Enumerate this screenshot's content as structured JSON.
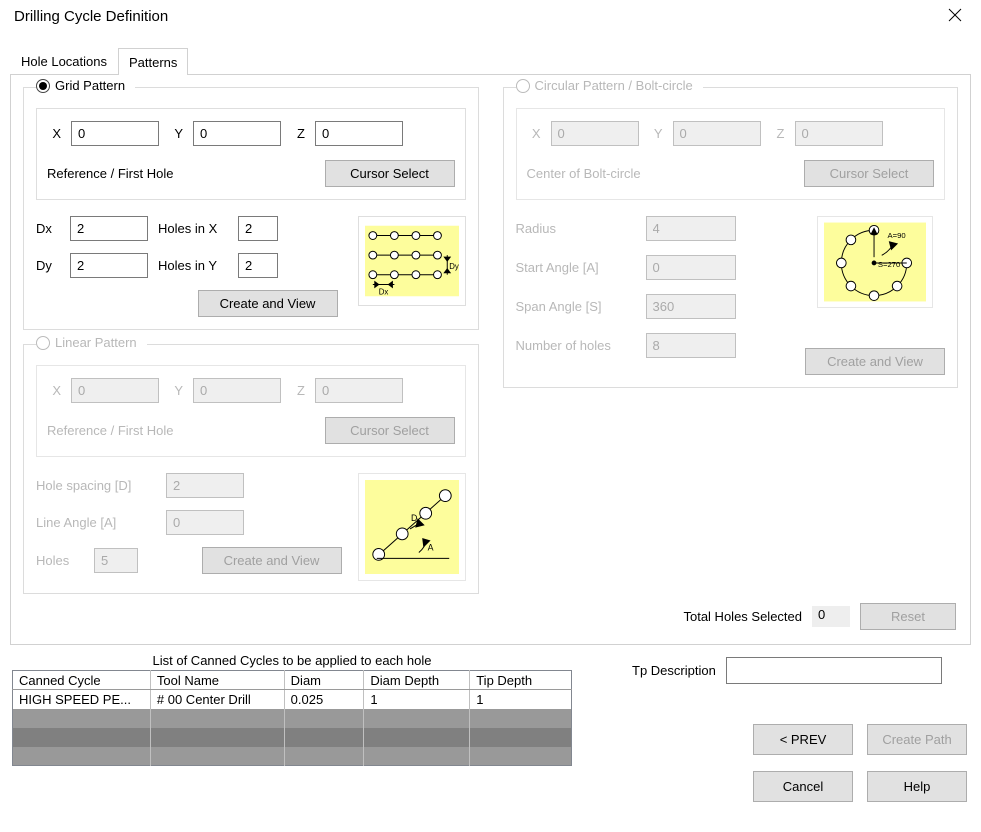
{
  "window": {
    "title": "Drilling Cycle Definition"
  },
  "tabs": {
    "hole_locations": "Hole Locations",
    "patterns": "Patterns",
    "selected": "patterns"
  },
  "grid": {
    "title": "Grid Pattern",
    "X": "X",
    "Xv": "0",
    "Y": "Y",
    "Yv": "0",
    "Z": "Z",
    "Zv": "0",
    "refLabel": "Reference / First Hole",
    "cursorSelect": "Cursor Select",
    "Dx": "Dx",
    "Dxv": "2",
    "HolesX": "Holes in X",
    "HolesXv": "2",
    "Dy": "Dy",
    "Dyv": "2",
    "HolesY": "Holes in Y",
    "HolesYv": "2",
    "createView": "Create and View"
  },
  "linear": {
    "title": "Linear Pattern",
    "Xv": "0",
    "Yv": "0",
    "Zv": "0",
    "refLabel": "Reference / First Hole",
    "cursorSelect": "Cursor Select",
    "spacing": "Hole spacing [D]",
    "spacingV": "2",
    "angle": "Line Angle [A]",
    "angleV": "0",
    "holes": "Holes",
    "holesV": "5",
    "createView": "Create and View"
  },
  "circular": {
    "title": "Circular Pattern / Bolt-circle",
    "Xv": "0",
    "Yv": "0",
    "Zv": "0",
    "centerLabel": "Center of Bolt-circle",
    "cursorSelect": "Cursor Select",
    "radius": "Radius",
    "radiusV": "4",
    "start": "Start Angle [A]",
    "startV": "0",
    "span": "Span Angle [S]",
    "spanV": "360",
    "num": "Number of holes",
    "numV": "8",
    "createView": "Create and View"
  },
  "totalHoles": {
    "label": "Total Holes Selected",
    "value": "0",
    "reset": "Reset"
  },
  "cycles": {
    "caption": "List of Canned Cycles to be applied to each hole",
    "cols": {
      "c1": "Canned Cycle",
      "c2": "Tool Name",
      "c3": "Diam",
      "c4": "Diam Depth",
      "c5": "Tip Depth"
    },
    "row": {
      "c1": "HIGH SPEED PE...",
      "c2": "# 00 Center Drill",
      "c3": "0.025",
      "c4": "1",
      "c5": "1"
    }
  },
  "tp": {
    "label": "Tp Description",
    "value": ""
  },
  "buttons": {
    "prev": "< PREV",
    "createPath": "Create Path",
    "cancel": "Cancel",
    "help": "Help"
  },
  "shared": {
    "X": "X",
    "Y": "Y",
    "Z": "Z"
  }
}
